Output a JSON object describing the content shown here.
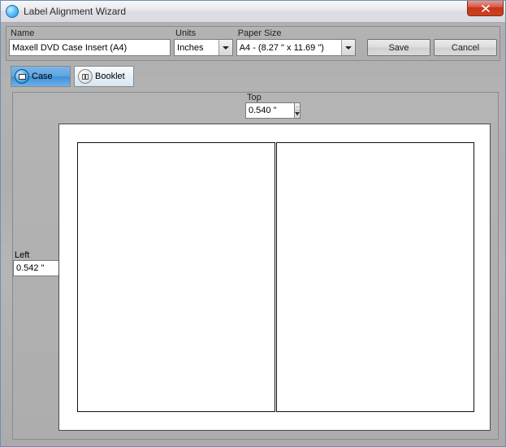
{
  "window": {
    "title": "Label Alignment Wizard"
  },
  "form": {
    "name_label": "Name",
    "name_value": "Maxell DVD Case Insert (A4)",
    "units_label": "Units",
    "units_value": "Inches",
    "paper_label": "Paper Size",
    "paper_value": "A4 - (8.27 \" x 11.69 \")",
    "save_label": "Save",
    "cancel_label": "Cancel"
  },
  "tabs": {
    "case": "Case",
    "booklet": "Booklet"
  },
  "margins": {
    "top_label": "Top",
    "top_value": "0.540 \"",
    "left_label": "Left",
    "left_value": "0.542 \""
  }
}
